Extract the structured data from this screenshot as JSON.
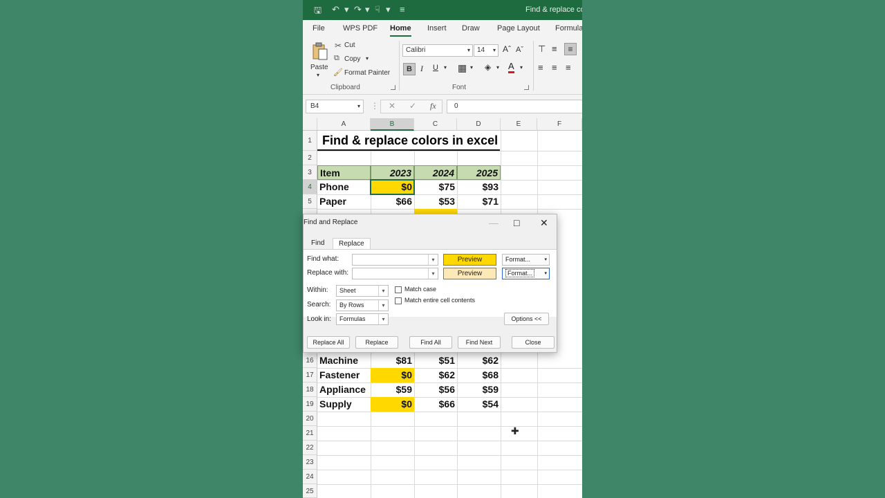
{
  "window": {
    "title": "Find & replace colo"
  },
  "ribbon": {
    "tabs": [
      "File",
      "WPS PDF",
      "Home",
      "Insert",
      "Draw",
      "Page Layout",
      "Formula"
    ],
    "active_tab": "Home",
    "clipboard": {
      "paste": "Paste",
      "cut": "Cut",
      "copy": "Copy",
      "format_painter": "Format Painter",
      "group_label": "Clipboard"
    },
    "font": {
      "name": "Calibri",
      "size": "14",
      "bold": "B",
      "italic": "I",
      "underline": "U",
      "group_label": "Font"
    }
  },
  "formula_bar": {
    "name_box": "B4",
    "value": "0"
  },
  "sheet": {
    "columns": [
      "A",
      "B",
      "C",
      "D",
      "E",
      "F"
    ],
    "selected_column": "B",
    "title": "Find & replace colors in excel",
    "header": {
      "item": "Item",
      "y1": "2023",
      "y2": "2024",
      "y3": "2025"
    },
    "rows": [
      {
        "row": "4",
        "item": "Phone",
        "y1": "$0",
        "y2": "$75",
        "y3": "$93",
        "y1_yellow": true
      },
      {
        "row": "5",
        "item": "Paper",
        "y1": "$66",
        "y2": "$53",
        "y3": "$71",
        "y1_yellow": false
      },
      {
        "row": "16",
        "item": "Machine",
        "y1": "$81",
        "y2": "$51",
        "y3": "$62",
        "y1_yellow": false
      },
      {
        "row": "17",
        "item": "Fastener",
        "y1": "$0",
        "y2": "$62",
        "y3": "$68",
        "y1_yellow": true
      },
      {
        "row": "18",
        "item": "Appliance",
        "y1": "$59",
        "y2": "$56",
        "y3": "$59",
        "y1_yellow": false
      },
      {
        "row": "19",
        "item": "Supply",
        "y1": "$0",
        "y2": "$66",
        "y3": "$54",
        "y1_yellow": true
      }
    ],
    "row_numbers_top": [
      "1",
      "2",
      "3",
      "4",
      "5"
    ],
    "row_numbers_bottom": [
      "16",
      "17",
      "18",
      "19",
      "20",
      "21",
      "22",
      "23",
      "24",
      "25"
    ]
  },
  "dialog": {
    "title": "Find and Replace",
    "tabs": [
      "Find",
      "Replace"
    ],
    "active_tab": "Replace",
    "find_what_label": "Find what:",
    "replace_with_label": "Replace with:",
    "find_preview": "Preview",
    "replace_preview": "Preview",
    "format_button": "Format...",
    "within_label": "Within:",
    "within_value": "Sheet",
    "search_label": "Search:",
    "search_value": "By Rows",
    "look_in_label": "Look in:",
    "look_in_value": "Formulas",
    "match_case": "Match case",
    "match_entire": "Match entire cell contents",
    "options_button": "Options <<",
    "replace_all": "Replace All",
    "replace": "Replace",
    "find_all": "Find All",
    "find_next": "Find Next",
    "close": "Close"
  },
  "colors": {
    "excel_green": "#1e6b40",
    "highlight_yellow": "#ffd800",
    "header_fill": "#c6dbb0",
    "replace_preview_fill": "#fde9b8"
  }
}
